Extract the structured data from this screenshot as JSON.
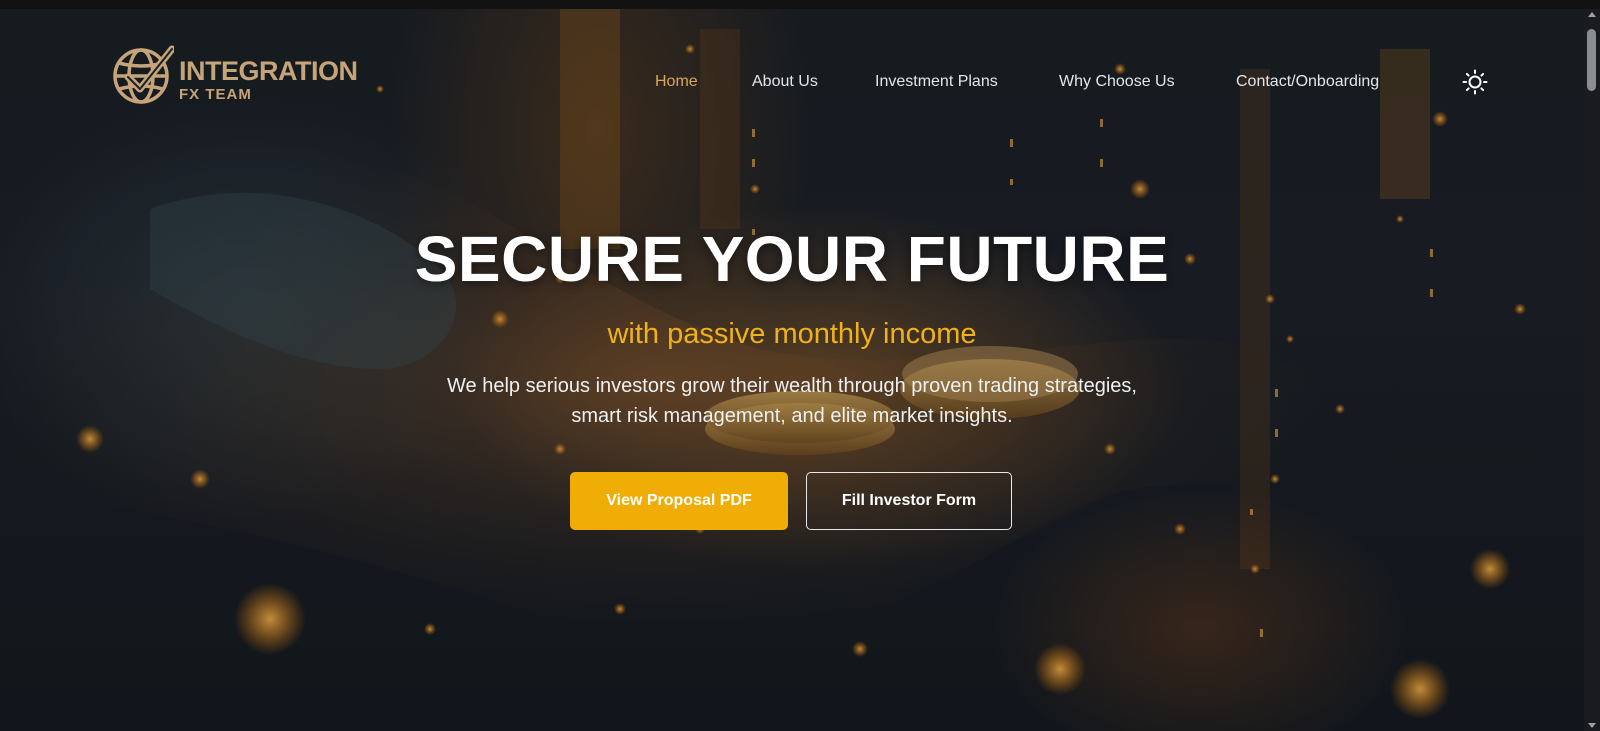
{
  "brand": {
    "line1": "INTEGRATION",
    "line2": "FX TEAM",
    "color": "#c6a47a"
  },
  "nav": {
    "items": [
      {
        "label": "Home",
        "active": true
      },
      {
        "label": "About Us",
        "active": false
      },
      {
        "label": "Investment Plans",
        "active": false
      },
      {
        "label": "Why Choose Us",
        "active": false
      },
      {
        "label": "Contact/Onboarding",
        "active": false
      }
    ],
    "theme_toggle_icon": "sun-icon"
  },
  "hero": {
    "title": "SECURE YOUR FUTURE",
    "subtitle": "with passive monthly income",
    "description": "We help serious investors grow their wealth through proven trading strategies, smart risk management, and elite market insights.",
    "primary_button": "View Proposal PDF",
    "secondary_button": "Fill Investor Form"
  },
  "colors": {
    "accent": "#efad05",
    "active_nav": "#d9a75c",
    "subtitle": "#f0b11a"
  }
}
